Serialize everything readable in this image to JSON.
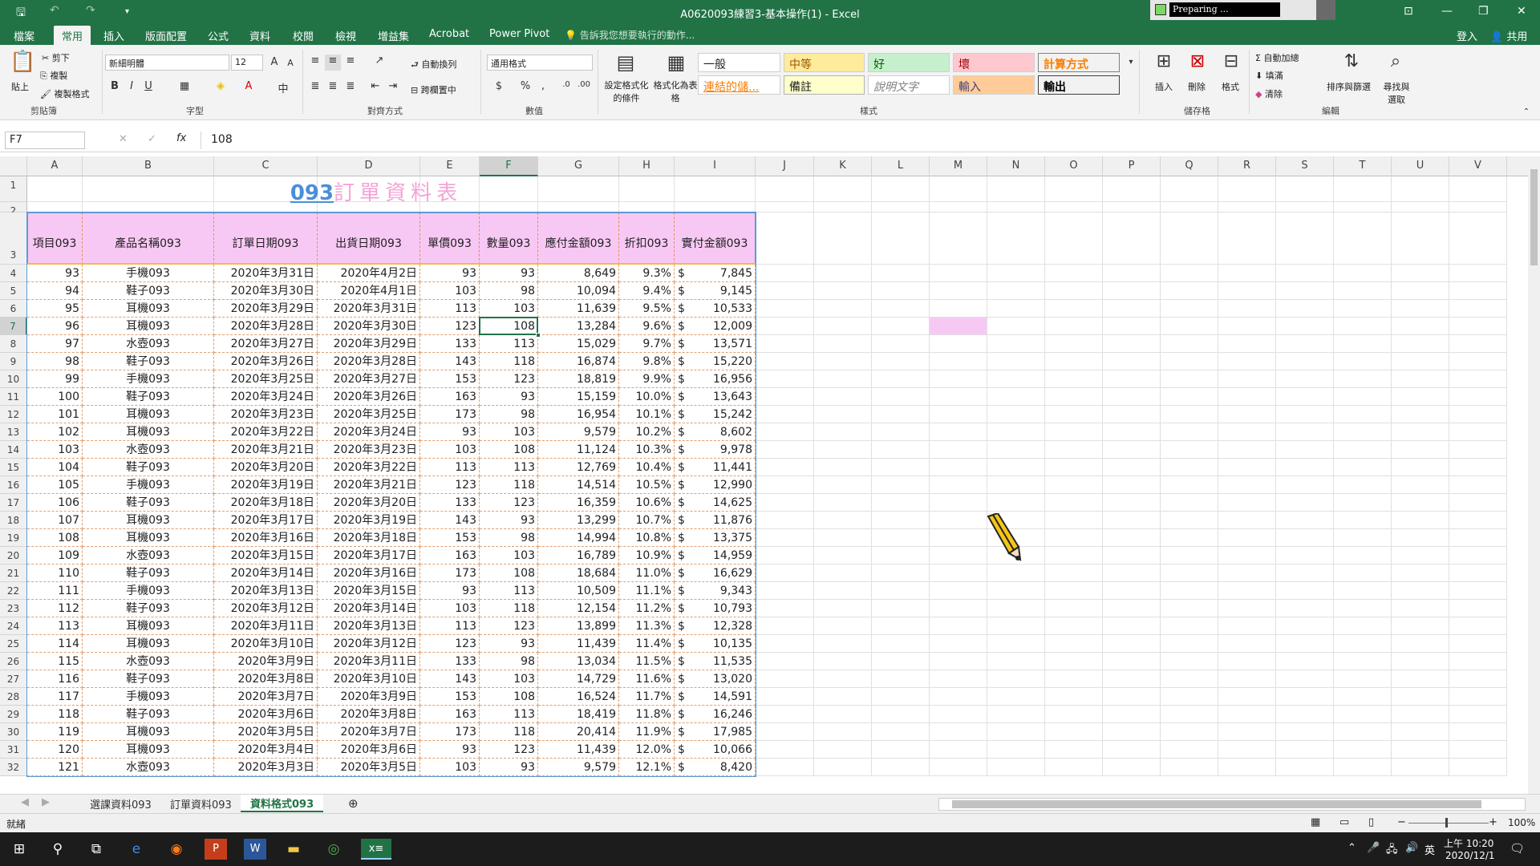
{
  "window": {
    "title": "A0620093練習3-基本操作(1) - Excel",
    "preparing": "Preparing ..."
  },
  "tabs": [
    "檔案",
    "常用",
    "插入",
    "版面配置",
    "公式",
    "資料",
    "校閱",
    "檢視",
    "增益集",
    "Acrobat",
    "Power Pivot"
  ],
  "active_tab": "常用",
  "tell_me": "告訴我您想要執行的動作...",
  "signin": "登入",
  "share": "共用",
  "ribbon": {
    "clipboard": {
      "paste": "貼上",
      "cut": "剪下",
      "copy": "複製",
      "format_painter": "複製格式",
      "label": "剪貼簿"
    },
    "font": {
      "name": "新細明體",
      "size": "12",
      "label": "字型"
    },
    "alignment": {
      "wrap": "自動換列",
      "merge": "跨欄置中",
      "label": "對齊方式"
    },
    "number": {
      "format": "通用格式",
      "label": "數值"
    },
    "styles": {
      "cond": "設定格式化的條件",
      "table": "格式化為表格",
      "label": "樣式",
      "cells": [
        "一般",
        "中等",
        "好",
        "壞",
        "計算方式",
        "連結的儲...",
        "備註",
        "說明文字",
        "輸入",
        "輸出"
      ]
    },
    "cells": {
      "insert": "插入",
      "delete": "刪除",
      "format": "格式",
      "label": "儲存格"
    },
    "editing": {
      "autosum": "自動加總",
      "fill": "填滿",
      "clear": "清除",
      "sort": "排序與篩選",
      "find": "尋找與選取",
      "label": "編輯"
    }
  },
  "formula_bar": {
    "name_box": "F7",
    "value": "108"
  },
  "columns": [
    "A",
    "B",
    "C",
    "D",
    "E",
    "F",
    "G",
    "H",
    "I",
    "J",
    "K",
    "L",
    "M",
    "N",
    "O",
    "P",
    "Q",
    "R",
    "S",
    "T",
    "U",
    "V"
  ],
  "selected_column": "F",
  "selected_row": "7",
  "sheet_title_num": "093",
  "sheet_title_text": "訂單資料表",
  "headers": [
    "項目093",
    "產品名稱093",
    "訂單日期093",
    "出貨日期093",
    "單價093",
    "數量093",
    "應付金額093",
    "折扣093",
    "實付金額093"
  ],
  "rows": [
    [
      "93",
      "手機093",
      "2020年3月31日",
      "2020年4月2日",
      "93",
      "93",
      "8,649",
      "9.3%",
      "7,845"
    ],
    [
      "94",
      "鞋子093",
      "2020年3月30日",
      "2020年4月1日",
      "103",
      "98",
      "10,094",
      "9.4%",
      "9,145"
    ],
    [
      "95",
      "耳機093",
      "2020年3月29日",
      "2020年3月31日",
      "113",
      "103",
      "11,639",
      "9.5%",
      "10,533"
    ],
    [
      "96",
      "耳機093",
      "2020年3月28日",
      "2020年3月30日",
      "123",
      "108",
      "13,284",
      "9.6%",
      "12,009"
    ],
    [
      "97",
      "水壺093",
      "2020年3月27日",
      "2020年3月29日",
      "133",
      "113",
      "15,029",
      "9.7%",
      "13,571"
    ],
    [
      "98",
      "鞋子093",
      "2020年3月26日",
      "2020年3月28日",
      "143",
      "118",
      "16,874",
      "9.8%",
      "15,220"
    ],
    [
      "99",
      "手機093",
      "2020年3月25日",
      "2020年3月27日",
      "153",
      "123",
      "18,819",
      "9.9%",
      "16,956"
    ],
    [
      "100",
      "鞋子093",
      "2020年3月24日",
      "2020年3月26日",
      "163",
      "93",
      "15,159",
      "10.0%",
      "13,643"
    ],
    [
      "101",
      "耳機093",
      "2020年3月23日",
      "2020年3月25日",
      "173",
      "98",
      "16,954",
      "10.1%",
      "15,242"
    ],
    [
      "102",
      "耳機093",
      "2020年3月22日",
      "2020年3月24日",
      "93",
      "103",
      "9,579",
      "10.2%",
      "8,602"
    ],
    [
      "103",
      "水壺093",
      "2020年3月21日",
      "2020年3月23日",
      "103",
      "108",
      "11,124",
      "10.3%",
      "9,978"
    ],
    [
      "104",
      "鞋子093",
      "2020年3月20日",
      "2020年3月22日",
      "113",
      "113",
      "12,769",
      "10.4%",
      "11,441"
    ],
    [
      "105",
      "手機093",
      "2020年3月19日",
      "2020年3月21日",
      "123",
      "118",
      "14,514",
      "10.5%",
      "12,990"
    ],
    [
      "106",
      "鞋子093",
      "2020年3月18日",
      "2020年3月20日",
      "133",
      "123",
      "16,359",
      "10.6%",
      "14,625"
    ],
    [
      "107",
      "耳機093",
      "2020年3月17日",
      "2020年3月19日",
      "143",
      "93",
      "13,299",
      "10.7%",
      "11,876"
    ],
    [
      "108",
      "耳機093",
      "2020年3月16日",
      "2020年3月18日",
      "153",
      "98",
      "14,994",
      "10.8%",
      "13,375"
    ],
    [
      "109",
      "水壺093",
      "2020年3月15日",
      "2020年3月17日",
      "163",
      "103",
      "16,789",
      "10.9%",
      "14,959"
    ],
    [
      "110",
      "鞋子093",
      "2020年3月14日",
      "2020年3月16日",
      "173",
      "108",
      "18,684",
      "11.0%",
      "16,629"
    ],
    [
      "111",
      "手機093",
      "2020年3月13日",
      "2020年3月15日",
      "93",
      "113",
      "10,509",
      "11.1%",
      "9,343"
    ],
    [
      "112",
      "鞋子093",
      "2020年3月12日",
      "2020年3月14日",
      "103",
      "118",
      "12,154",
      "11.2%",
      "10,793"
    ],
    [
      "113",
      "耳機093",
      "2020年3月11日",
      "2020年3月13日",
      "113",
      "123",
      "13,899",
      "11.3%",
      "12,328"
    ],
    [
      "114",
      "耳機093",
      "2020年3月10日",
      "2020年3月12日",
      "123",
      "93",
      "11,439",
      "11.4%",
      "10,135"
    ],
    [
      "115",
      "水壺093",
      "2020年3月9日",
      "2020年3月11日",
      "133",
      "98",
      "13,034",
      "11.5%",
      "11,535"
    ],
    [
      "116",
      "鞋子093",
      "2020年3月8日",
      "2020年3月10日",
      "143",
      "103",
      "14,729",
      "11.6%",
      "13,020"
    ],
    [
      "117",
      "手機093",
      "2020年3月7日",
      "2020年3月9日",
      "153",
      "108",
      "16,524",
      "11.7%",
      "14,591"
    ],
    [
      "118",
      "鞋子093",
      "2020年3月6日",
      "2020年3月8日",
      "163",
      "113",
      "18,419",
      "11.8%",
      "16,246"
    ],
    [
      "119",
      "耳機093",
      "2020年3月5日",
      "2020年3月7日",
      "173",
      "118",
      "20,414",
      "11.9%",
      "17,985"
    ],
    [
      "120",
      "耳機093",
      "2020年3月4日",
      "2020年3月6日",
      "93",
      "123",
      "11,439",
      "12.0%",
      "10,066"
    ],
    [
      "121",
      "水壺093",
      "2020年3月3日",
      "2020年3月5日",
      "103",
      "93",
      "9,579",
      "12.1%",
      "8,420"
    ]
  ],
  "currency": "$",
  "sheet_tabs": [
    "選課資料093",
    "訂單資料093",
    "資料格式093"
  ],
  "active_sheet": "資料格式093",
  "status": {
    "ready": "就緒",
    "zoom": "100%"
  },
  "clock": {
    "time": "上午 10:20",
    "date": "2020/12/1",
    "ime": "英"
  },
  "colors": {
    "excel_green": "#217346",
    "header_pink": "#f8c8f4",
    "title_pink": "#f5a3d6",
    "title_blue": "#4a8fd8"
  }
}
